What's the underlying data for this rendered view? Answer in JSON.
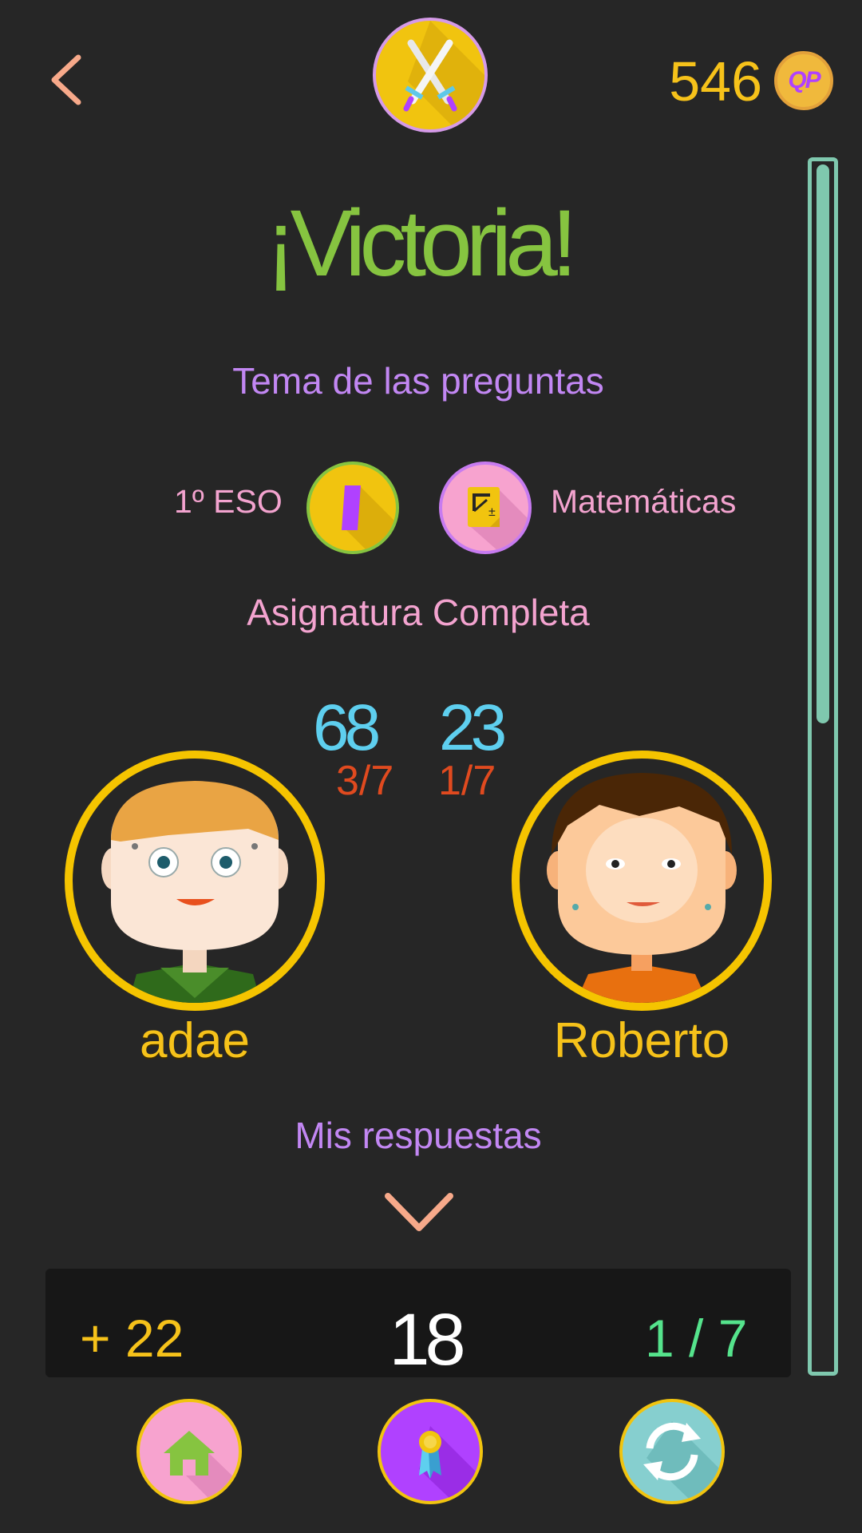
{
  "header": {
    "coins": "546",
    "coin_label": "QP"
  },
  "result": {
    "title": "¡Victoria!"
  },
  "topic": {
    "heading": "Tema de las preguntas",
    "grade": "1º ESO",
    "subject": "Matemáticas",
    "scope": "Asignatura Completa"
  },
  "match": {
    "player": {
      "name": "adae",
      "score": "68",
      "correct": "3/7"
    },
    "opponent": {
      "name": "Roberto",
      "score": "23",
      "correct": "1/7"
    }
  },
  "answers": {
    "heading": "Mis respuestas",
    "row": {
      "points": "+ 22",
      "score": "18",
      "fraction": "1 / 7"
    }
  },
  "colors": {
    "background": "#262626",
    "victory_green": "#86c440",
    "gold": "#f6c21a",
    "purple": "#c287f3",
    "pink": "#f3a3cf",
    "score_blue": "#5ecfef",
    "fraction_red": "#e04a1f",
    "scroll_teal": "#7fc8ae"
  },
  "icons": {
    "back": "chevron-left-icon",
    "mode": "crossed-swords-icon",
    "grade": "grade-bar-icon",
    "subject": "math-notebook-icon",
    "expand": "chevron-down-icon",
    "home": "home-icon",
    "medal": "medal-icon",
    "replay": "refresh-icon"
  }
}
